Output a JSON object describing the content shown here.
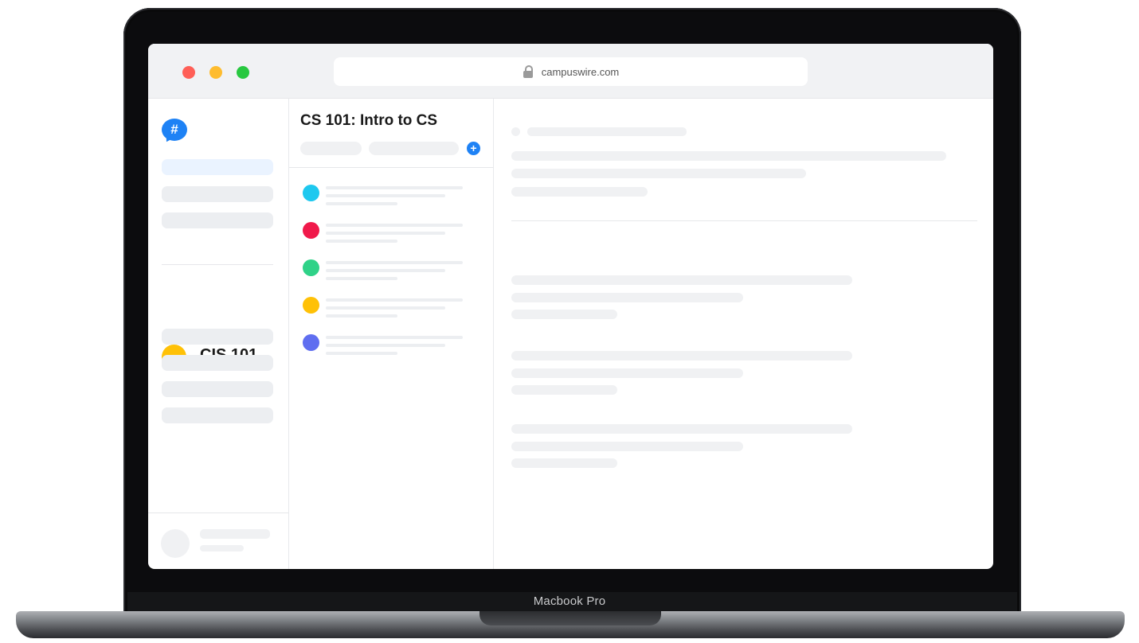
{
  "device": {
    "label": "Macbook Pro"
  },
  "browser": {
    "url": "campuswire.com",
    "lock_icon": "lock-icon"
  },
  "sidebar": {
    "logo_glyph": "#",
    "course": {
      "name": "CIS 101",
      "color": "#ffc107"
    }
  },
  "feed": {
    "title": "CS 101: Intro to CS",
    "new_post_glyph": "+",
    "post_colors": [
      "#1ec8ef",
      "#f0194a",
      "#2fd288",
      "#ffc107",
      "#5f6ef0"
    ]
  },
  "colors": {
    "brand": "#1e82f5",
    "skeleton": "#eceef1"
  }
}
